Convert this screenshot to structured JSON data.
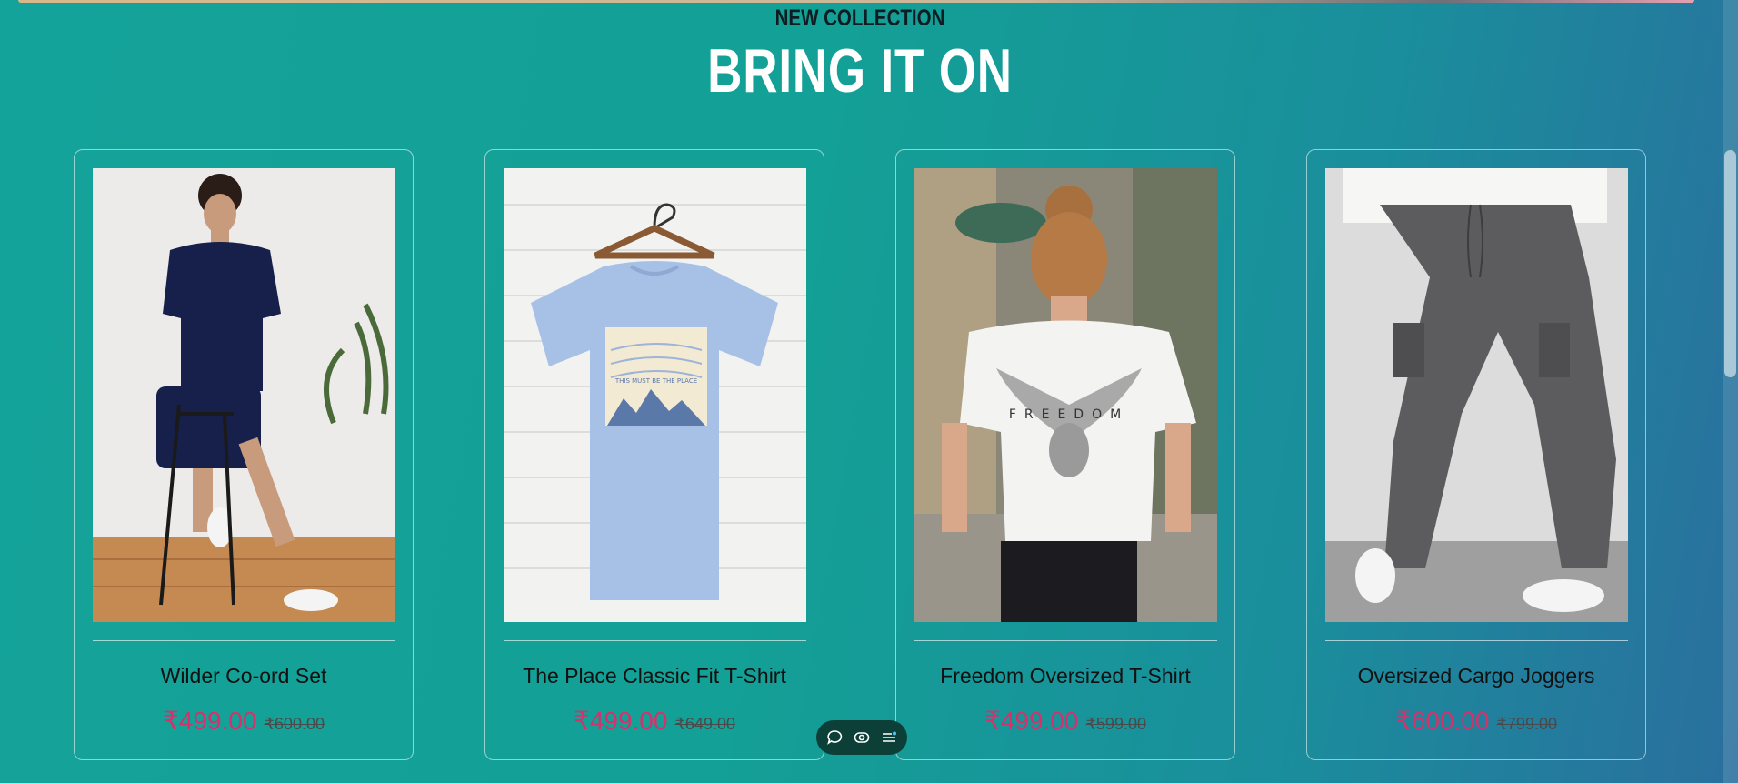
{
  "section": {
    "eyebrow": "NEW COLLECTION",
    "headline": "BRING IT ON"
  },
  "products": [
    {
      "name": "Wilder Co-ord Set",
      "price": "₹499.00",
      "compare_price": "₹600.00",
      "image_icon": "model-seated-navy-coord-image"
    },
    {
      "name": "The Place Classic Fit T-Shirt",
      "price": "₹499.00",
      "compare_price": "₹649.00",
      "image_icon": "blue-tshirt-on-hanger-image",
      "print_text": "THIS MUST BE THE PLACE"
    },
    {
      "name": "Freedom Oversized T-Shirt",
      "price": "₹499.00",
      "compare_price": "₹599.00",
      "image_icon": "woman-white-freedom-tee-image",
      "print_text": "FREEDOM"
    },
    {
      "name": "Oversized Cargo Joggers",
      "price": "₹600.00",
      "compare_price": "₹799.00",
      "image_icon": "grey-cargo-joggers-image"
    }
  ],
  "floating_toolbar": {
    "icons": [
      "chat-icon",
      "eye-icon",
      "menu-list-icon"
    ]
  },
  "colors": {
    "accent_price": "#d5316b",
    "background": "#14a39a",
    "toolbar": "#0c3f37"
  }
}
